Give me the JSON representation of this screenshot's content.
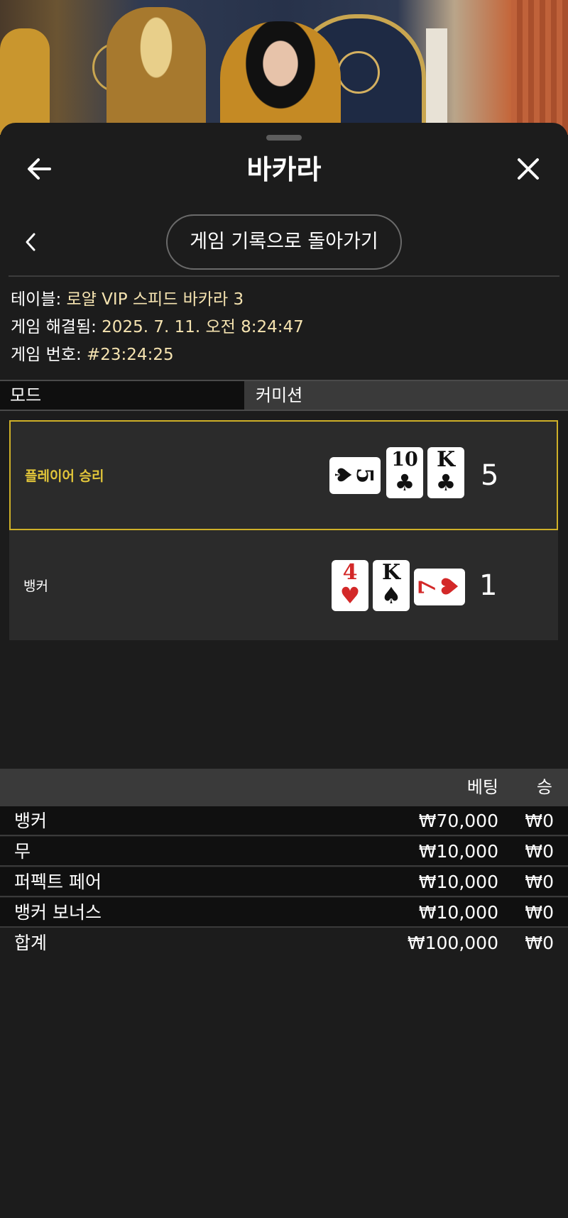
{
  "header": {
    "title": "바카라",
    "back_icon": "arrow-left-icon",
    "close_icon": "close-icon"
  },
  "nav": {
    "return_label": "게임 기록으로 돌아가기",
    "prev_icon": "chevron-left-icon"
  },
  "details": {
    "table_label": "테이블: ",
    "table_value": "로얄 VIP 스피드 바카라 3",
    "resolved_label": "게임 해결됨: ",
    "resolved_value": "2025. 7. 11. 오전 8:24:47",
    "number_label": "게임 번호: ",
    "number_value": "#23:24:25"
  },
  "mode": {
    "label": "모드",
    "value": "커미션"
  },
  "hands": {
    "player": {
      "label": "플레이어 승리",
      "score": "5",
      "winner": true,
      "cards": [
        {
          "rank": "5",
          "suit": "♠",
          "orientation": "horizontal"
        },
        {
          "rank": "10",
          "suit": "♣",
          "orientation": "vertical"
        },
        {
          "rank": "K",
          "suit": "♣",
          "orientation": "vertical"
        }
      ]
    },
    "banker": {
      "label": "뱅커",
      "score": "1",
      "winner": false,
      "cards": [
        {
          "rank": "4",
          "suit": "♥",
          "orientation": "vertical"
        },
        {
          "rank": "K",
          "suit": "♠",
          "orientation": "vertical"
        },
        {
          "rank": "7",
          "suit": "♥",
          "orientation": "horizontal"
        }
      ]
    }
  },
  "bets": {
    "headers": {
      "bet": "베팅",
      "win": "승"
    },
    "rows": [
      {
        "name": "뱅커",
        "bet": "₩70,000",
        "win": "₩0"
      },
      {
        "name": "무",
        "bet": "₩10,000",
        "win": "₩0"
      },
      {
        "name": "퍼펙트 페어",
        "bet": "₩10,000",
        "win": "₩0"
      },
      {
        "name": "뱅커 보너스",
        "bet": "₩10,000",
        "win": "₩0"
      }
    ],
    "total": {
      "name": "합계",
      "bet": "₩100,000",
      "win": "₩0"
    }
  },
  "colors": {
    "accent": "#cfb028",
    "value_text": "#f5e3b0",
    "background": "#1c1c1c"
  }
}
